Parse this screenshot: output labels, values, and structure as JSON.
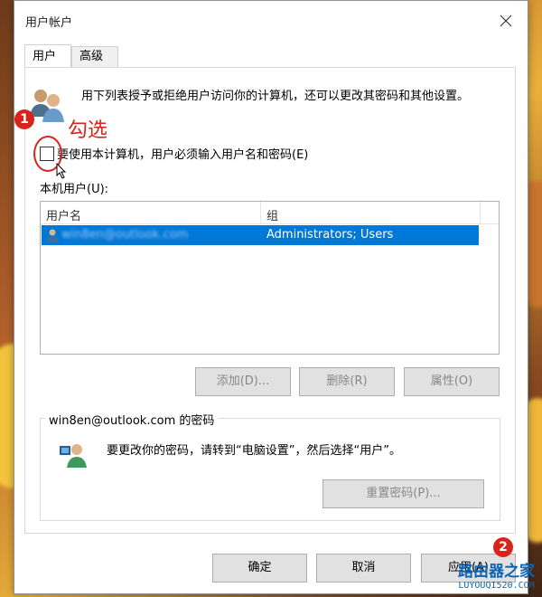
{
  "window": {
    "title": "用户帐户"
  },
  "tabs": [
    {
      "label": "用户"
    },
    {
      "label": "高级"
    }
  ],
  "users_tab": {
    "intro": "用下列表授予或拒绝用户访问你的计算机，还可以更改其密码和其他设置。",
    "checkbox_label": "要使用本计算机，用户必须输入用户名和密码(E)",
    "checkbox_checked": false,
    "list_label": "本机用户(U):",
    "columns": [
      "用户名",
      "组"
    ],
    "rows": [
      {
        "name": "win8en@outlook.com",
        "group": "Administrators; Users",
        "selected": true
      }
    ],
    "buttons": {
      "add": "添加(D)...",
      "remove": "删除(R)",
      "properties": "属性(O)"
    },
    "password_group": {
      "title": "win8en@outlook.com 的密码",
      "text": "要更改你的密码，请转到“电脑设置”，然后选择“用户”。",
      "reset_button": "重置密码(P)..."
    }
  },
  "footer": {
    "ok": "确定",
    "cancel": "取消",
    "apply": "应用(A)"
  },
  "annotations": {
    "step1": "1",
    "step1_text": "勾选",
    "step2": "2"
  },
  "watermark": {
    "line1": "路由器之家",
    "line2": "LUYOUQI520.COM"
  },
  "colors": {
    "selection": "#0078d7",
    "annotation": "#d9241c",
    "watermark": "#0d64b4"
  }
}
